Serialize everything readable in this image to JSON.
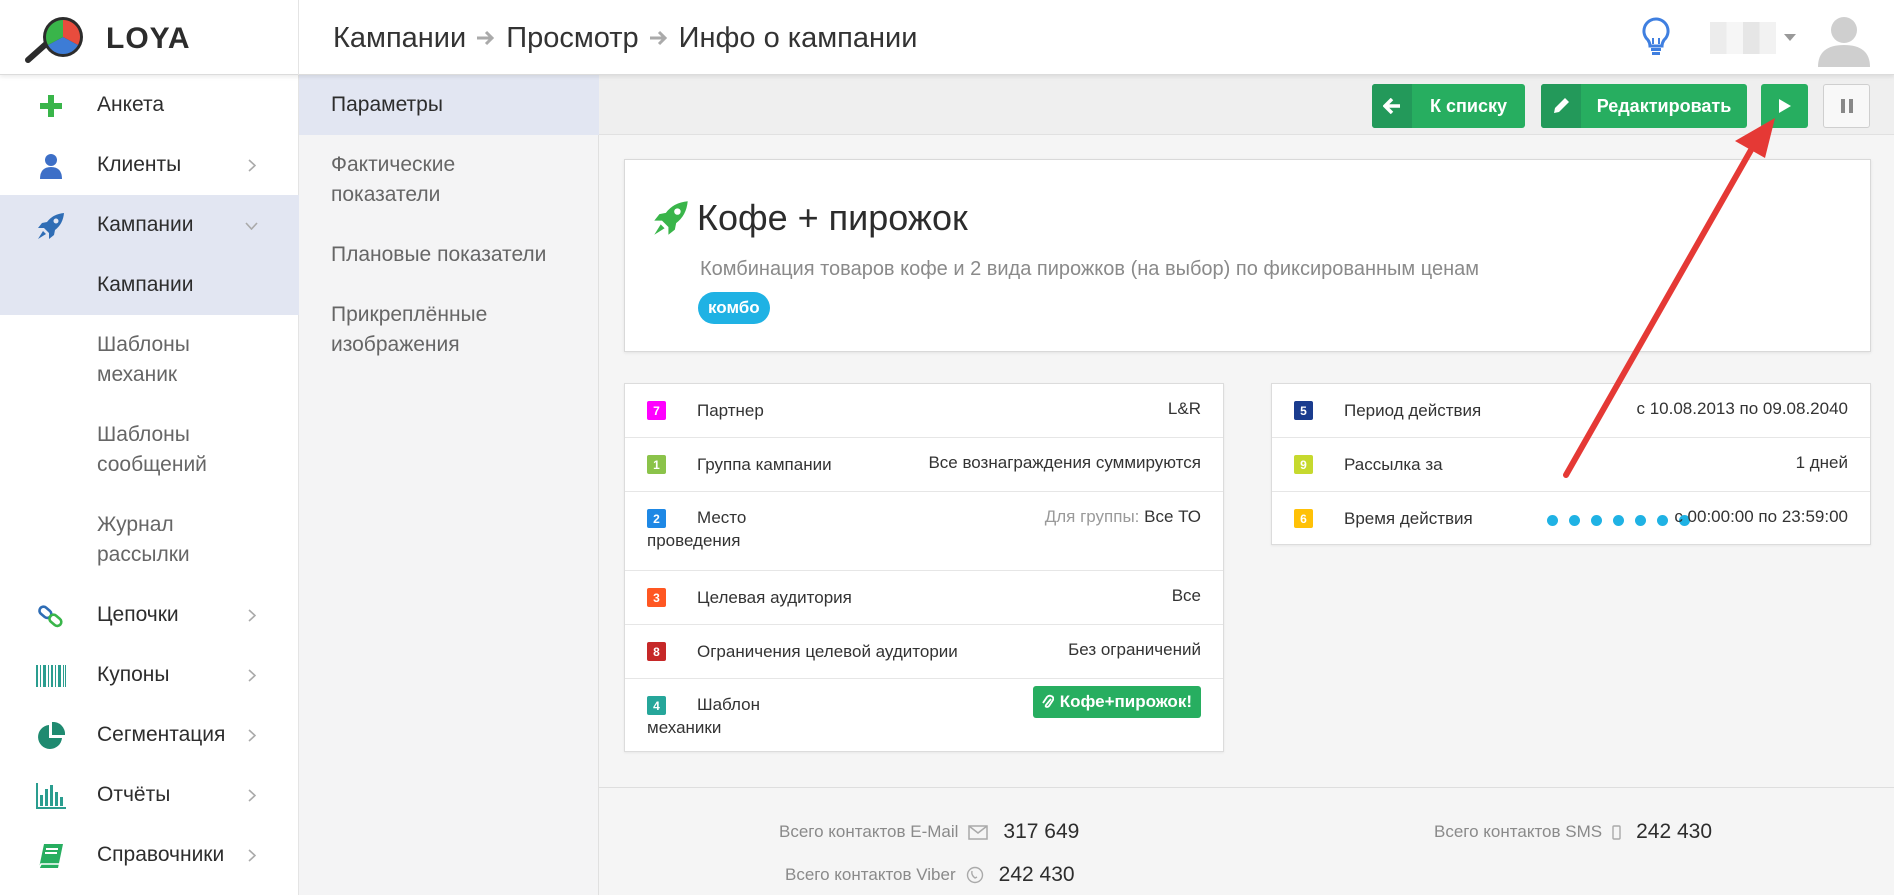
{
  "app": {
    "logo_text": "LOYA"
  },
  "breadcrumb": [
    "Кампании",
    "Просмотр",
    "Инфо о кампании"
  ],
  "sidebar": {
    "items": [
      {
        "label": "Анкета",
        "icon": "plus-icon"
      },
      {
        "label": "Клиенты",
        "icon": "user-icon"
      },
      {
        "label": "Кампании",
        "icon": "rocket-icon"
      },
      {
        "label": "Цепочки",
        "icon": "chain-icon"
      },
      {
        "label": "Купоны",
        "icon": "barcode-icon"
      },
      {
        "label": "Сегментация",
        "icon": "pie-chart-icon"
      },
      {
        "label": "Отчёты",
        "icon": "bar-chart-icon"
      },
      {
        "label": "Справочники",
        "icon": "book-icon"
      }
    ],
    "sub_items": [
      "Кампании",
      "Шаблоны механик",
      "Шаблоны сообщений",
      "Журнал рассылки"
    ]
  },
  "subnav": [
    "Параметры",
    "Фактические показатели",
    "Плановые показатели",
    "Прикреплённые изображения"
  ],
  "toolbar": {
    "back_label": "К списку",
    "edit_label": "Редактировать"
  },
  "campaign": {
    "title": "Кофе + пирожок",
    "description": "Комбинация товаров кофе и 2 вида пирожков (на выбор) по фиксированным ценам",
    "tag": "комбо"
  },
  "params_left": [
    {
      "badge": "7",
      "label": "Партнер",
      "value": "L&R"
    },
    {
      "badge": "1",
      "label": "Группа кампании",
      "value": "Все вознаграждения суммируются"
    },
    {
      "badge": "2",
      "label": "Место проведения",
      "value_prefix": "Для группы:",
      "value": "Все ТО"
    },
    {
      "badge": "3",
      "label": "Целевая аудитория",
      "value": "Все"
    },
    {
      "badge": "8",
      "label": "Ограничения целевой аудитории",
      "value": "Без ограничений"
    },
    {
      "badge": "4",
      "label": "Шаблон механики",
      "value": "Кофе+пирожок!"
    }
  ],
  "params_right": [
    {
      "badge": "5",
      "label": "Период действия",
      "value": "с 10.08.2013 по 09.08.2040"
    },
    {
      "badge": "9",
      "label": "Рассылка за",
      "value": "1 дней"
    },
    {
      "badge": "6",
      "label": "Время действия",
      "value": "с 00:00:00 по 23:59:00"
    }
  ],
  "stats": {
    "email_label": "Всего контактов E-Mail",
    "email_value": "317 649",
    "sms_label": "Всего контактов SMS",
    "sms_value": "242 430",
    "viber_label": "Всего контактов Viber",
    "viber_value": "242 430"
  },
  "colors": {
    "green": "#27ae60",
    "blue_tag": "#1fb2e4",
    "active_bg": "#e2e6f2",
    "arrow": "#e53935",
    "badge_7": "#ff00ff",
    "badge_1": "#8bc34a",
    "badge_2": "#1e88e5",
    "badge_3": "#ff5722",
    "badge_8": "#c62828",
    "badge_4": "#26a69a",
    "badge_5": "#1a3c8e",
    "badge_9": "#c6d92e",
    "badge_6": "#ffc107"
  }
}
